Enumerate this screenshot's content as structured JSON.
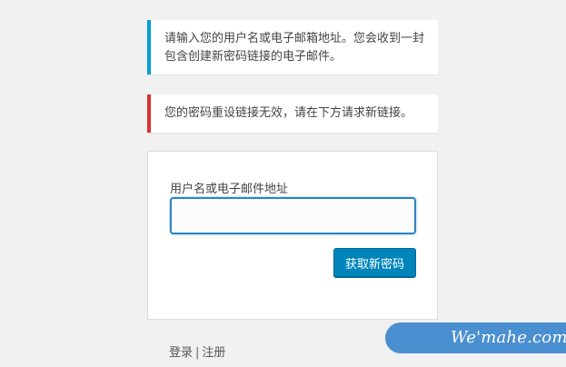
{
  "notices": {
    "info": "请输入您的用户名或电子邮箱地址。您会收到一封包含创建新密码链接的电子邮件。",
    "error": "您的密码重设链接无效，请在下方请求新链接。"
  },
  "form": {
    "label": "用户名或电子邮件地址",
    "value": "",
    "submit_label": "获取新密码"
  },
  "nav": {
    "login": "登录",
    "separator": "|",
    "register": "注册"
  },
  "watermark": {
    "text": "We'mahe.com"
  },
  "colors": {
    "info_accent": "#00a0d2",
    "error_accent": "#dc3232",
    "primary_button": "#0085ba"
  }
}
